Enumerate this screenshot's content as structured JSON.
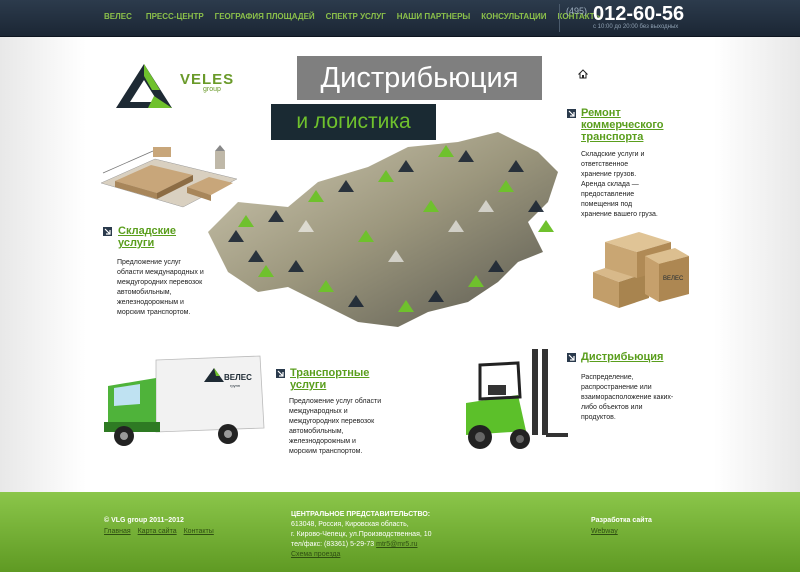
{
  "nav": {
    "items": [
      "ВЕЛЕС",
      "ПРЕСС-ЦЕНТР",
      "ГЕОГРАФИЯ ПЛОЩАДЕЙ",
      "СПЕКТР УСЛУГ",
      "НАШИ ПАРТНЕРЫ",
      "КОНСУЛЬТАЦИИ",
      "КОНТАКТЫ"
    ]
  },
  "contact": {
    "code": "(495)",
    "phone": "012-60-56",
    "hours": "с 10:00 до 20:00 без выходных"
  },
  "logo": {
    "name": "VELES",
    "sub": "group"
  },
  "banner": {
    "line1": "Дистрибьюция",
    "line2": "и логистика"
  },
  "van_label": {
    "name": "ВЕЛЕС",
    "sub": "групп"
  },
  "box_label": "ВЕЛЕС",
  "sections": {
    "storage": {
      "title_line1": "Складские",
      "title_line2": "услуги",
      "desc": [
        "Предложение услуг",
        "области международных и",
        "междугородних перевозок",
        "автомобильным,",
        "железнодорожным и",
        "морским транспортом."
      ]
    },
    "repair": {
      "title_line1": "Ремонт",
      "title_line2": "коммерческого",
      "title_line3": "транспорта",
      "desc": [
        "Складские услуги и",
        "ответственное",
        "хранение грузов.",
        "Аренда склада —",
        "предоставление",
        "помещения под",
        "хранение вашего груза."
      ]
    },
    "transport": {
      "title_line1": "Транспортные",
      "title_line2": "услуги",
      "desc": [
        "Предложение услуг области",
        "международных и",
        "междугородних перевозок",
        "автомобильным,",
        "железнодорожным и",
        "морским транспортом."
      ]
    },
    "distribution": {
      "title_line1": "Дистрибьюция",
      "desc": [
        "Распределение,",
        "распространение или",
        "взаиморасположение каких-",
        "либо объектов или",
        "продуктов."
      ]
    }
  },
  "footer": {
    "copyright": "© VLG group 2011–2012",
    "links": [
      "Главная",
      "Карта сайта",
      "Контакты"
    ],
    "office_title": "ЦЕНТРАЛЬНОЕ ПРЕДСТАВИТЕЛЬСТВО:",
    "office_line1": "613048, Россия, Кировская область,",
    "office_line2": "г. Кирово-Чепецк, ул.Производственная, 10",
    "office_phone": "тел/факс: (83361) 5-29-73",
    "office_email": "mtr5@mr5.ru",
    "map_link": "Схема проезда",
    "dev_title": "Разработка сайта",
    "dev_link": "Webway"
  },
  "colors": {
    "accent_green": "#6fc12d",
    "nav_bg": "#1b2634",
    "footer_green": "#7ab83a",
    "dark_box": "#1a2a33"
  },
  "icons": {
    "home": "home-icon",
    "section_arrow": "arrow-down-right-icon"
  }
}
